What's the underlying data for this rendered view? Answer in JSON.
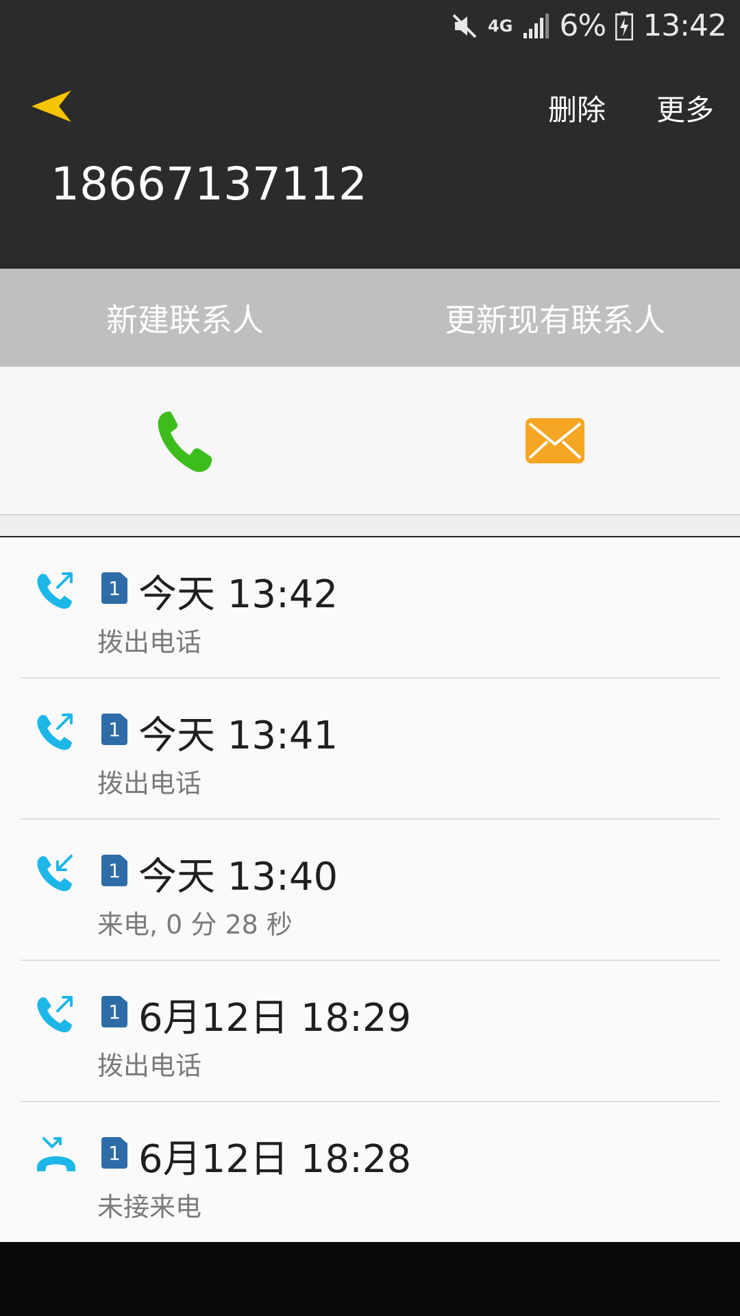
{
  "status_bar": {
    "mute_icon": "mute-icon",
    "network": "4G",
    "signal_icon": "signal-icon",
    "battery_percent": "6%",
    "battery_icon": "battery-charging-icon",
    "time": "13:42"
  },
  "header": {
    "back_icon": "back-arrow-icon",
    "delete_label": "删除",
    "more_label": "更多",
    "phone_number": "18667137112"
  },
  "contact_actions": {
    "new_contact": "新建联系人",
    "update_contact": "更新现有联系人"
  },
  "actions": {
    "call_icon": "phone-icon",
    "message_icon": "message-icon",
    "call_color": "#3cbd1c",
    "message_color": "#f5a623"
  },
  "call_log": [
    {
      "type": "outgoing",
      "icon": "outgoing-call-icon",
      "sim": "1",
      "time": "今天 13:42",
      "desc": "拨出电话"
    },
    {
      "type": "outgoing",
      "icon": "outgoing-call-icon",
      "sim": "1",
      "time": "今天 13:41",
      "desc": "拨出电话"
    },
    {
      "type": "incoming",
      "icon": "incoming-call-icon",
      "sim": "1",
      "time": "今天 13:40",
      "desc": "来电, 0 分 28 秒"
    },
    {
      "type": "outgoing",
      "icon": "outgoing-call-icon",
      "sim": "1",
      "time": "6月12日 18:29",
      "desc": "拨出电话"
    },
    {
      "type": "missed",
      "icon": "missed-call-icon",
      "sim": "1",
      "time": "6月12日 18:28",
      "desc": "未接来电"
    }
  ],
  "colors": {
    "header_bg": "#2b2b2b",
    "back_arrow": "#f6c400",
    "call_log_icon": "#1cb7e8",
    "sim_badge": "#2e6ca8"
  }
}
